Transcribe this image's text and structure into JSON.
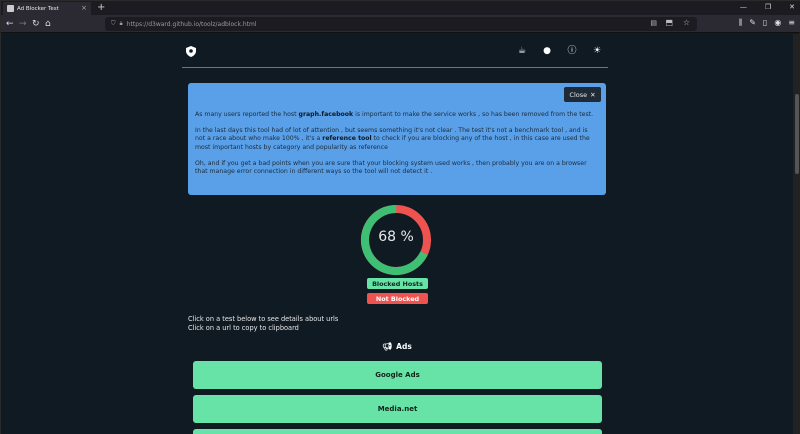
{
  "browser": {
    "tab_title": "Ad Blocker Test",
    "url": "https://d3ward.github.io/toolz/adblock.html"
  },
  "notice": {
    "close_label": "Close",
    "p1_pre": "As many users reported the host ",
    "p1_bold": "graph.facebook",
    "p1_post": " is important to make the service works , so has been removed from the test.",
    "p2_pre": "In the last days this tool had of lot of attention , but seems something it's not clear . The test it's not a benchmark tool , and is not a race about who make 100% , it's a ",
    "p2_bold": "reference tool",
    "p2_post": " to check if you are blocking any of the host , in this case are used the most important hosts by category and popularity as reference",
    "p3": "Oh, and if you get a bad points when you are sure that your blocking system used works , then probably you are on a browser that manage error connection in different ways so the tool will not detect it ."
  },
  "gauge": {
    "percent_label": "68 %",
    "value": 68,
    "blocked_color": "#3fbf74",
    "not_blocked_color": "#ef5350"
  },
  "legend": {
    "blocked": "Blocked Hosts",
    "not_blocked": "Not Blocked"
  },
  "hints": {
    "line1": "Click on a test below to see details about urls",
    "line2": "Click on a url to copy to clipboard"
  },
  "section": {
    "title": "Ads",
    "items": [
      "Google Ads",
      "Media.net",
      ""
    ]
  },
  "colors": {
    "accent_blue": "#5aa0e8",
    "green": "#67e3a8",
    "red": "#ef5350",
    "background": "#0f1a23"
  }
}
